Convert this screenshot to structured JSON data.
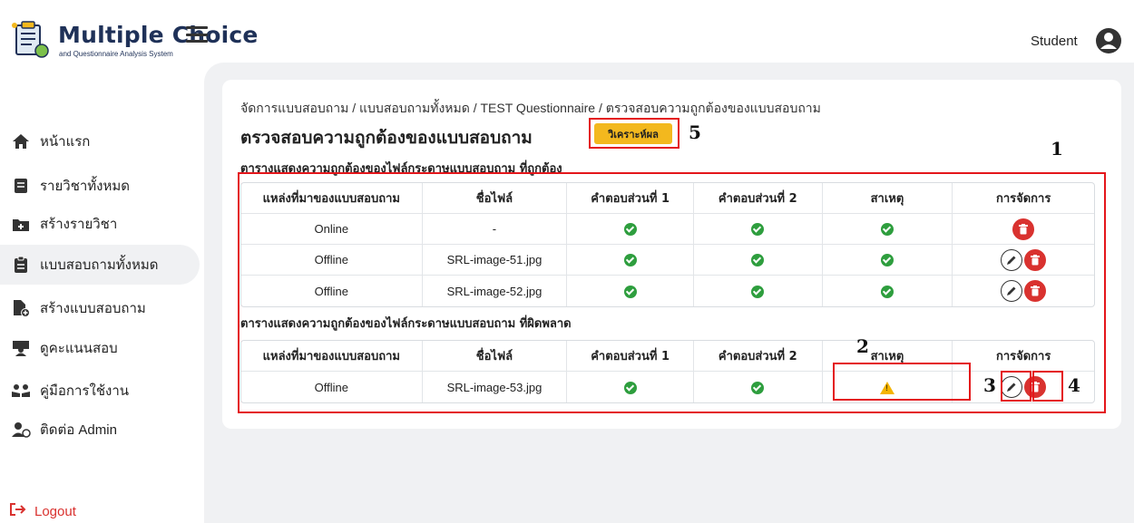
{
  "header": {
    "brand_title": "Multiple Choice",
    "brand_subtitle": "and Questionnaire Analysis System",
    "user_name": "Student"
  },
  "sidebar": {
    "items": [
      {
        "label": "หน้าแรก",
        "icon": "home-icon"
      },
      {
        "label": "รายวิชาทั้งหมด",
        "icon": "book-icon"
      },
      {
        "label": "สร้างรายวิชา",
        "icon": "add-folder-icon"
      },
      {
        "label": "แบบสอบถามทั้งหมด",
        "icon": "clipboard-icon",
        "active": true
      },
      {
        "label": "สร้างแบบสอบถาม",
        "icon": "add-file-icon"
      },
      {
        "label": "ดูคะแนนสอบ",
        "icon": "teacher-icon"
      },
      {
        "label": "คู่มือการใช้งาน",
        "icon": "reading-icon"
      },
      {
        "label": "ติดต่อ Admin",
        "icon": "contact-icon"
      }
    ],
    "logout_label": "Logout"
  },
  "main": {
    "breadcrumb": "จัดการแบบสอบถาม / แบบสอบถามทั้งหมด / TEST Questionnaire / ตรวจสอบความถูกต้องของแบบสอบถาม",
    "page_title": "ตรวจสอบความถูกต้องของแบบสอบถาม",
    "analyze_button": "วิเคราะห์ผล",
    "correct_section_title": "ตารางแสดงความถูกต้องของไฟล์กระดาษแบบสอบถาม ที่ถูกต้อง",
    "error_section_title": "ตารางแสดงความถูกต้องของไฟล์กระดาษแบบสอบถาม ที่ผิดพลาด",
    "columns": [
      "แหล่งที่มาของแบบสอบถาม",
      "ชื่อไฟล์",
      "คำตอบส่วนที่ 1",
      "คำตอบส่วนที่ 2",
      "สาเหตุ",
      "การจัดการ"
    ],
    "correct_rows": [
      {
        "source": "Online",
        "file": "-",
        "part1": "check",
        "part2": "check",
        "cause": "check",
        "actions": [
          "delete"
        ]
      },
      {
        "source": "Offline",
        "file": "SRL-image-51.jpg",
        "part1": "check",
        "part2": "check",
        "cause": "check",
        "actions": [
          "edit",
          "delete"
        ]
      },
      {
        "source": "Offline",
        "file": "SRL-image-52.jpg",
        "part1": "check",
        "part2": "check",
        "cause": "check",
        "actions": [
          "edit",
          "delete"
        ]
      }
    ],
    "error_rows": [
      {
        "source": "Offline",
        "file": "SRL-image-53.jpg",
        "part1": "check",
        "part2": "check",
        "cause": "warning",
        "actions": [
          "edit",
          "delete"
        ]
      }
    ]
  },
  "annotations": [
    "1",
    "2",
    "3",
    "4",
    "5"
  ],
  "colors": {
    "brand": "#1f3158",
    "accent_button": "#f3b81e",
    "check": "#2e9e3e",
    "delete": "#d9322f",
    "warning": "#f5b400",
    "annotation": "#e4161b"
  }
}
